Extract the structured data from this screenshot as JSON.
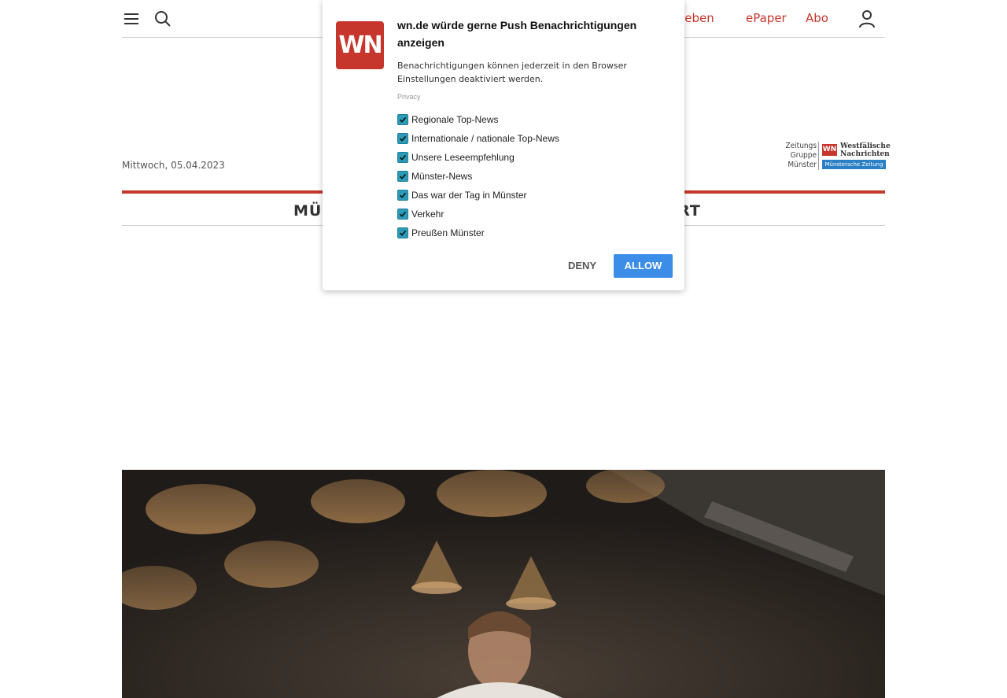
{
  "header": {
    "menu_icon": "menu-icon",
    "search_icon": "search-icon",
    "links": [
      "ufgeben",
      "ePaper",
      "Abo"
    ],
    "user_icon": "user-icon"
  },
  "date": "Mittwoch, 05.04.2023",
  "brand": {
    "zgm_lines": [
      "Zeitungs",
      "Gruppe",
      "Münster"
    ],
    "wn_badge": "WN",
    "wn_name_lines": [
      "Westfälische",
      "Nachrichten"
    ],
    "mz_name": "Münstersche Zeitung"
  },
  "nav": {
    "left_fragment": "MÜ",
    "right_fragment": "ORT"
  },
  "dialog": {
    "logo": "WN",
    "title": "wn.de würde gerne Push Benachrichtigungen anzeigen",
    "description": "Benachrichtigungen können jederzeit in den Browser Einstellungen deaktiviert werden.",
    "privacy": "Privacy",
    "options": [
      {
        "label": "Regionale Top-News",
        "checked": true
      },
      {
        "label": "Internationale / nationale Top-News",
        "checked": true
      },
      {
        "label": "Unsere Leseempfehlung",
        "checked": true
      },
      {
        "label": "Münster-News",
        "checked": true
      },
      {
        "label": "Das war der Tag in Münster",
        "checked": true
      },
      {
        "label": "Verkehr",
        "checked": true
      },
      {
        "label": "Preußen Münster",
        "checked": true
      }
    ],
    "deny": "DENY",
    "allow": "ALLOW"
  },
  "colors": {
    "brand_red": "#c7362c",
    "allow_blue": "#3b8de8",
    "checkbox_teal": "#2d9bb7"
  }
}
